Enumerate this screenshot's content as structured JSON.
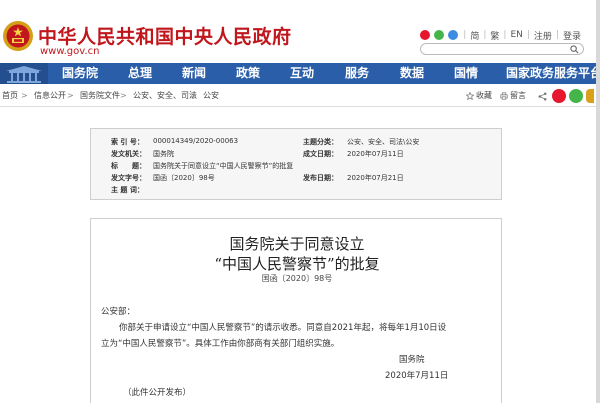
{
  "header": {
    "title": "中华人民共和国中央人民政府",
    "url": "www.gov.cn",
    "links": [
      "简",
      "繁",
      "EN",
      "登录",
      "注册",
      "登录"
    ],
    "link_colors": {
      "weibo": "#e6162d",
      "wechat": "#44b549",
      "app": "#3d8be2"
    }
  },
  "nav": {
    "items": [
      "国务院",
      "总理",
      "新闻",
      "政策",
      "互动",
      "服务",
      "数据",
      "国情",
      "国家政务服务平台"
    ],
    "active_index": 0
  },
  "breadcrumb": {
    "items": [
      "首页",
      "信息公开",
      "国务院文件",
      "公安、安全、司法",
      "公安"
    ],
    "separator": ">",
    "actions": {
      "favorite": "收藏",
      "print": "留言"
    }
  },
  "meta": {
    "rows": [
      {
        "label_left": "索 引 号：",
        "value_left": "000014349/2020-00063",
        "label_right": "主题分类：",
        "value_right": "公安、安全、司法\\公安"
      },
      {
        "label_left": "发文机关：",
        "value_left": "国务院",
        "label_right": "成文日期：",
        "value_right": "2020年07月11日"
      },
      {
        "label_left": "标　　题：",
        "value_left": "国务院关于同意设立“中国人民警察节”的批复",
        "label_right": "",
        "value_right": ""
      },
      {
        "label_left": "发文字号：",
        "value_left": "国函〔2020〕98号",
        "label_right": "发布日期：",
        "value_right": "2020年07月21日"
      },
      {
        "label_left": "主 题 词：",
        "value_left": "",
        "label_right": "",
        "value_right": ""
      }
    ]
  },
  "document": {
    "title_line1": "国务院关于同意设立",
    "title_line2": "“中国人民警察节”的批复",
    "doc_number": "国函〔2020〕98号",
    "salutation": "公安部：",
    "body_line1": "你部关于申请设立“中国人民警察节”的请示收悉。同意自2021年起，将每年1月10日设",
    "body_line2": "立为“中国人民警察节”。具体工作由你部商有关部门组织实施。",
    "signer": "国务院",
    "date": "2020年7月11日",
    "note": "（此件公开发布）"
  }
}
